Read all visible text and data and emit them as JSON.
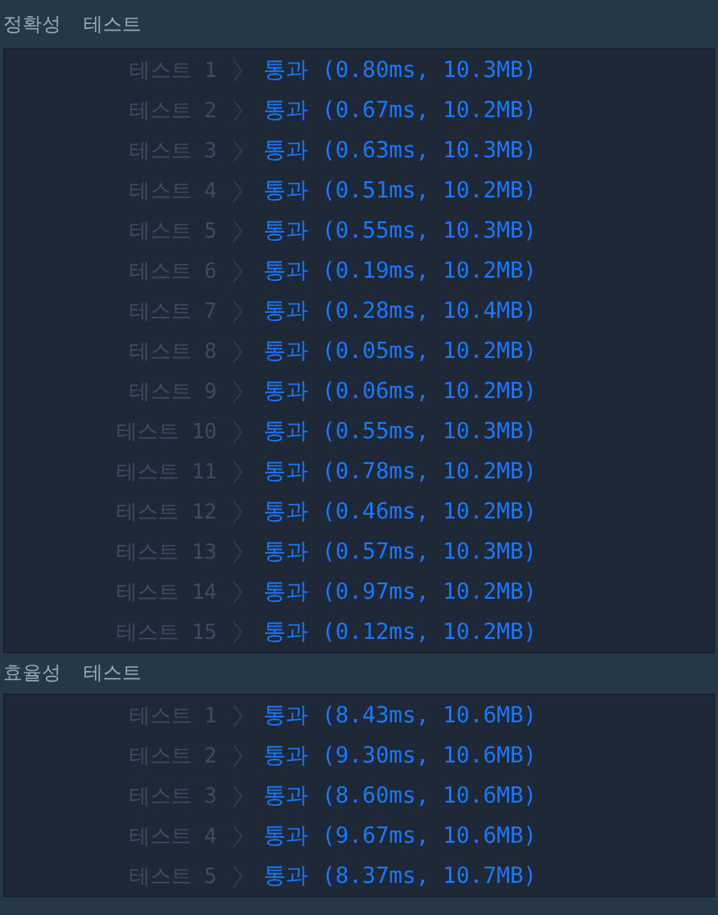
{
  "sections": [
    {
      "title": "정확성",
      "subtitle": "테스트",
      "rows": [
        {
          "label": "테스트 1",
          "result": "통과 (0.80ms, 10.3MB)"
        },
        {
          "label": "테스트 2",
          "result": "통과 (0.67ms, 10.2MB)"
        },
        {
          "label": "테스트 3",
          "result": "통과 (0.63ms, 10.3MB)"
        },
        {
          "label": "테스트 4",
          "result": "통과 (0.51ms, 10.2MB)"
        },
        {
          "label": "테스트 5",
          "result": "통과 (0.55ms, 10.3MB)"
        },
        {
          "label": "테스트 6",
          "result": "통과 (0.19ms, 10.2MB)"
        },
        {
          "label": "테스트 7",
          "result": "통과 (0.28ms, 10.4MB)"
        },
        {
          "label": "테스트 8",
          "result": "통과 (0.05ms, 10.2MB)"
        },
        {
          "label": "테스트 9",
          "result": "통과 (0.06ms, 10.2MB)"
        },
        {
          "label": "테스트 10",
          "result": "통과 (0.55ms, 10.3MB)"
        },
        {
          "label": "테스트 11",
          "result": "통과 (0.78ms, 10.2MB)"
        },
        {
          "label": "테스트 12",
          "result": "통과 (0.46ms, 10.2MB)"
        },
        {
          "label": "테스트 13",
          "result": "통과 (0.57ms, 10.3MB)"
        },
        {
          "label": "테스트 14",
          "result": "통과 (0.97ms, 10.2MB)"
        },
        {
          "label": "테스트 15",
          "result": "통과 (0.12ms, 10.2MB)"
        }
      ]
    },
    {
      "title": "효율성",
      "subtitle": "테스트",
      "rows": [
        {
          "label": "테스트 1",
          "result": "통과 (8.43ms, 10.6MB)"
        },
        {
          "label": "테스트 2",
          "result": "통과 (9.30ms, 10.6MB)"
        },
        {
          "label": "테스트 3",
          "result": "통과 (8.60ms, 10.6MB)"
        },
        {
          "label": "테스트 4",
          "result": "통과 (9.67ms, 10.6MB)"
        },
        {
          "label": "테스트 5",
          "result": "통과 (8.37ms, 10.7MB)"
        }
      ]
    }
  ]
}
